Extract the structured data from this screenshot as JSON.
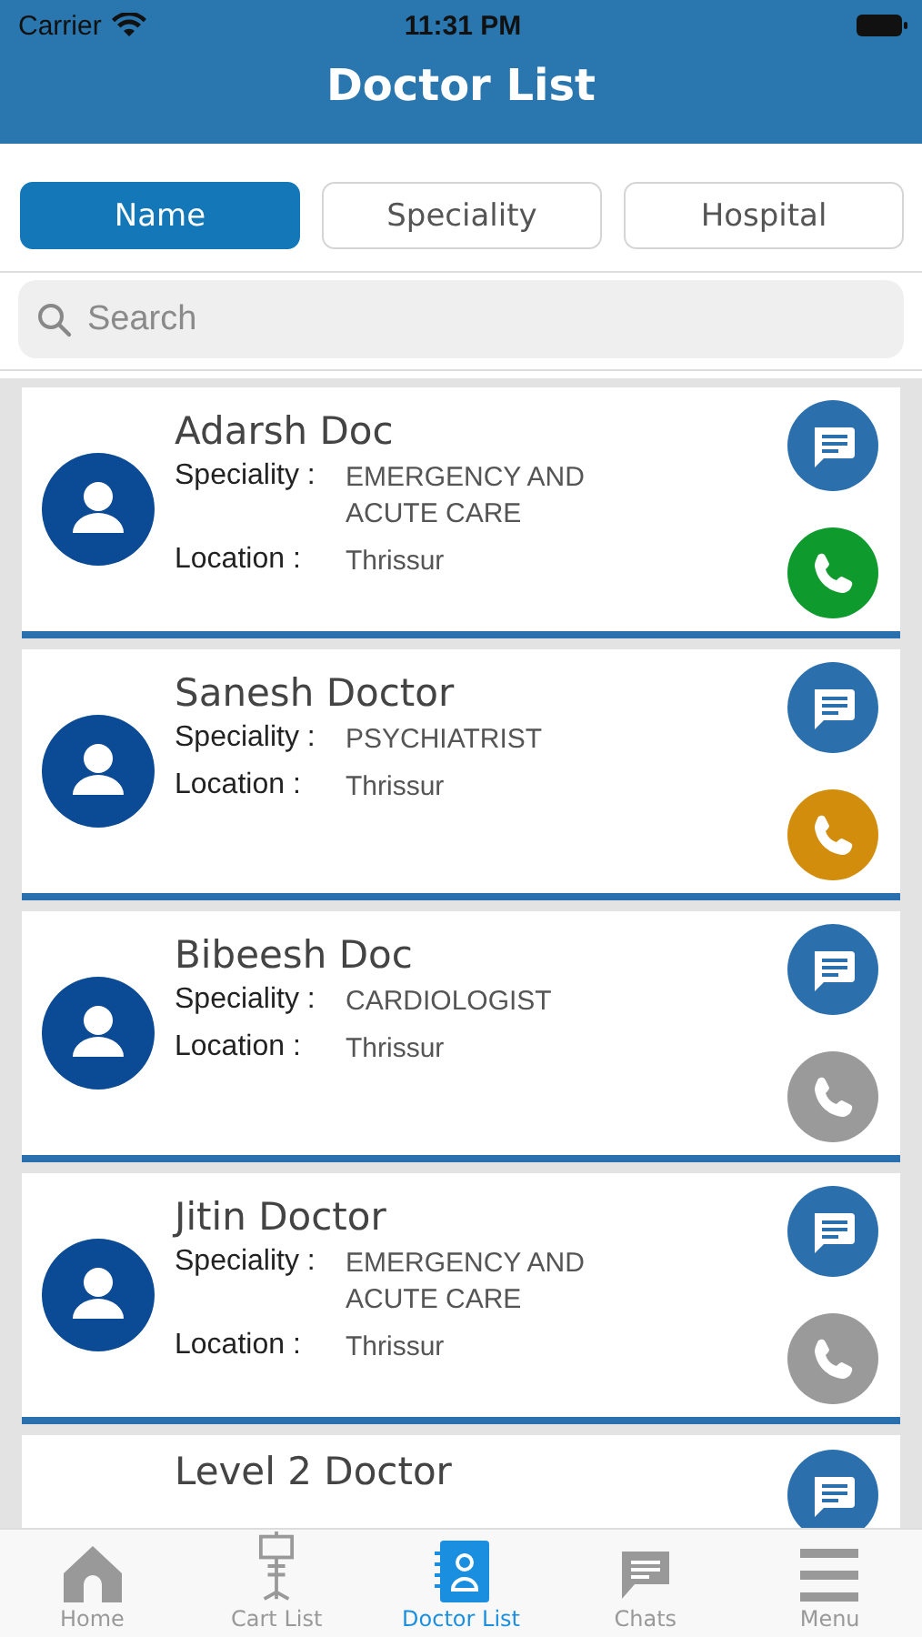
{
  "status_bar": {
    "carrier": "Carrier",
    "time": "11:31 PM"
  },
  "header": {
    "title": "Doctor List"
  },
  "filters": [
    {
      "label": "Name",
      "selected": true
    },
    {
      "label": "Speciality",
      "selected": false
    },
    {
      "label": "Hospital",
      "selected": false
    }
  ],
  "search": {
    "placeholder": "Search"
  },
  "doctors": [
    {
      "name": "Adarsh  Doc",
      "speciality_label": "Speciality :",
      "speciality": "EMERGENCY AND ACUTE CARE",
      "location_label": "Location :",
      "location": "Thrissur",
      "color": "#0f9a2e"
    },
    {
      "name": "Sanesh  Doctor",
      "speciality_label": "Speciality :",
      "speciality": "PSYCHIATRIST",
      "location_label": "Location :",
      "location": "Thrissur",
      "color": "#d38d0c"
    },
    {
      "name": "Bibeesh  Doc",
      "speciality_label": "Speciality :",
      "speciality": "CARDIOLOGIST",
      "location_label": "Location :",
      "location": "Thrissur",
      "color": "#9a9a9a"
    },
    {
      "name": "Jitin Doctor",
      "speciality_label": "Speciality :",
      "speciality": "EMERGENCY AND ACUTE CARE",
      "location_label": "Location :",
      "location": "Thrissur",
      "color": "#9a9a9a"
    },
    {
      "name": "Level 2 Doctor"
    }
  ],
  "tab_bar": [
    {
      "label": "Home",
      "kind": "home",
      "selected": false
    },
    {
      "label": "Cart List",
      "kind": "cart",
      "selected": false
    },
    {
      "label": "Doctor List",
      "kind": "doctors",
      "selected": true
    },
    {
      "label": "Chats",
      "kind": "chats",
      "selected": false
    },
    {
      "label": "Menu",
      "kind": "menu",
      "selected": false
    }
  ]
}
